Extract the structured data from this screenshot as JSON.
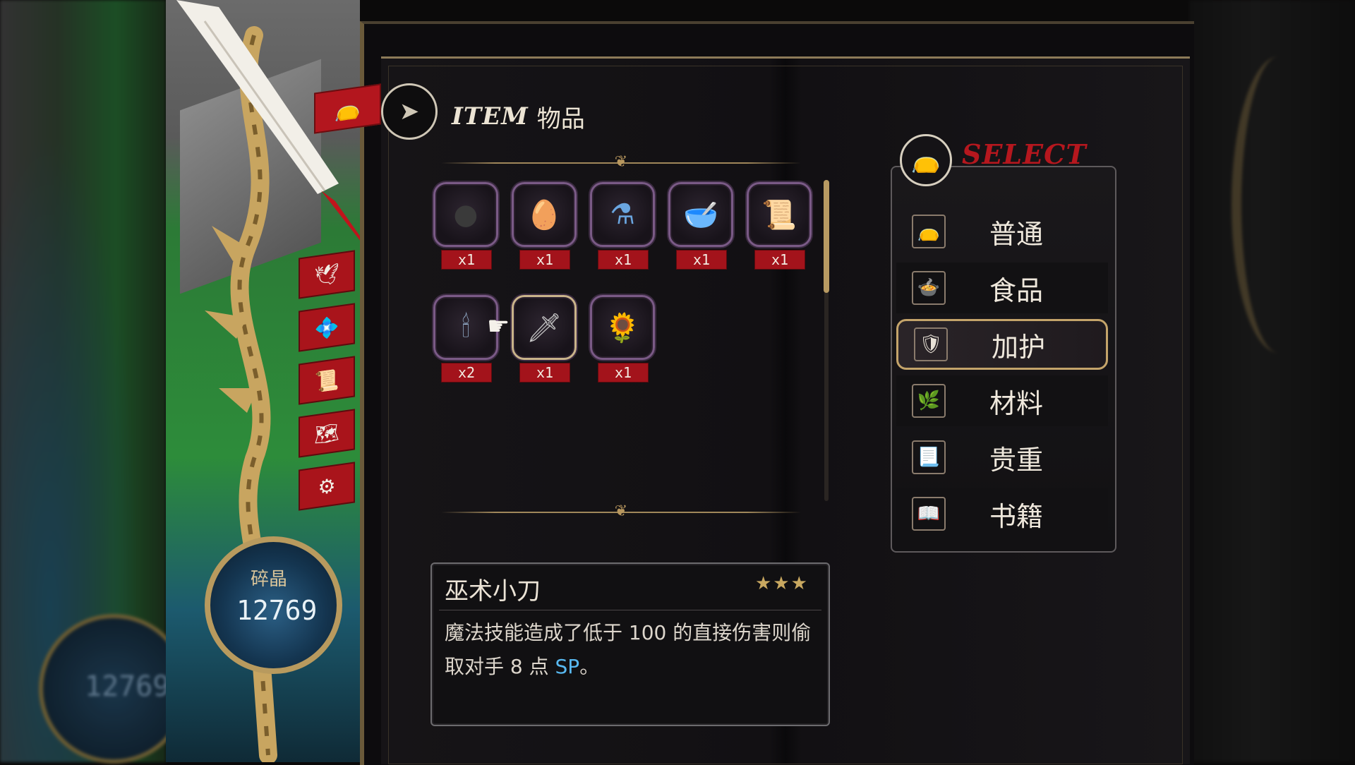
{
  "header": {
    "title_en": "ITEM",
    "title_cn": "物品"
  },
  "items": [
    {
      "icon": "dark-orb-icon",
      "glyph": "●",
      "qty": "x1",
      "color": "#3a3a3a"
    },
    {
      "icon": "egg-icon",
      "glyph": "🥚",
      "qty": "x1",
      "color": "#e8e0cc"
    },
    {
      "icon": "potion-icon",
      "glyph": "⚗",
      "qty": "x1",
      "color": "#6aa6e0"
    },
    {
      "icon": "bowl-icon",
      "glyph": "🥣",
      "qty": "x1",
      "color": "#c0683a"
    },
    {
      "icon": "scroll-icon",
      "glyph": "📜",
      "qty": "x1",
      "color": "#d9c8a8"
    },
    {
      "icon": "candle-icon",
      "glyph": "🕯",
      "qty": "x2",
      "color": "#a8c8e8"
    },
    {
      "icon": "dagger-icon",
      "glyph": "🗡",
      "qty": "x1",
      "color": "#c8c8c8"
    },
    {
      "icon": "sunflower-icon",
      "glyph": "🌻",
      "qty": "x1",
      "color": "#e0a030"
    }
  ],
  "description": {
    "name": "巫术小刀",
    "stars": "★★★",
    "text_before": "魔法技能造成了低于 100 的直接伤害则偷取对手 8 点 ",
    "text_highlight": "SP",
    "text_after": "。"
  },
  "select": {
    "title": "SELECT",
    "categories": [
      {
        "label": "普通",
        "icon": "bag-icon",
        "glyph": "👝"
      },
      {
        "label": "食品",
        "icon": "food-icon",
        "glyph": "🍲"
      },
      {
        "label": "加护",
        "icon": "blessing-icon",
        "glyph": "🛡"
      },
      {
        "label": "材料",
        "icon": "herb-icon",
        "glyph": "🌿"
      },
      {
        "label": "贵重",
        "icon": "scroll-icon",
        "glyph": "📃"
      },
      {
        "label": "书籍",
        "icon": "book-icon",
        "glyph": "📖"
      }
    ],
    "active_index": 2
  },
  "currency": {
    "label": "碎晶",
    "value": "12769"
  },
  "colors": {
    "accent_red": "#a9141b",
    "gold": "#b89a5e",
    "highlight_blue": "#58b8f0"
  }
}
